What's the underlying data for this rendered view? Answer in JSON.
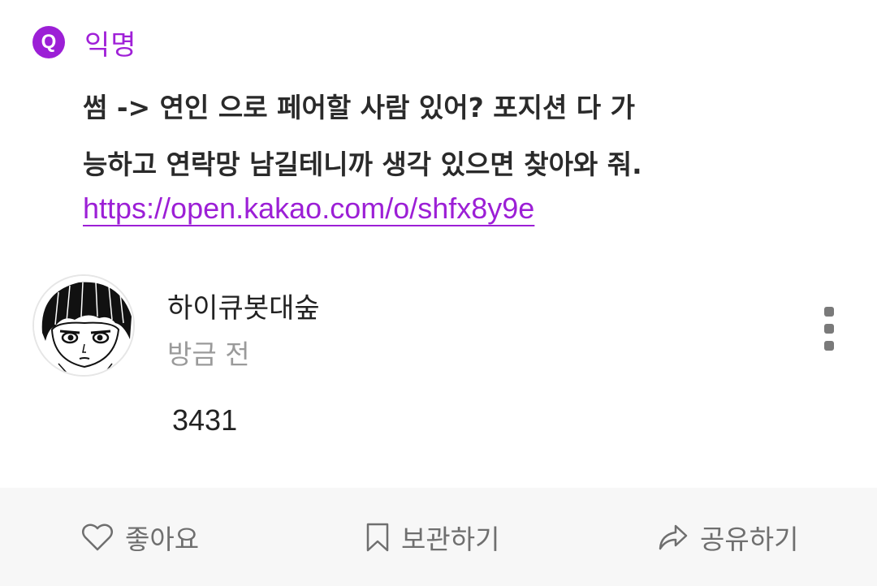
{
  "header": {
    "badge": "Q",
    "anonymous_label": "익명"
  },
  "question": {
    "lines": [
      "썸 -> 연인 으로 페어할 사람 있어? 포지션 다 가",
      "능하고 연락망 남길테니까 생각 있으면 찾아와 줘."
    ],
    "link": "https://open.kakao.com/o/shfx8y9e"
  },
  "answer": {
    "author": "하이큐봇대숲",
    "time": "방금 전",
    "text": "3431"
  },
  "actions": {
    "like_label": "좋아요",
    "save_label": "보관하기",
    "share_label": "공유하기"
  },
  "colors": {
    "accent": "#9c1fd6",
    "bottom_bar": "#f7f7f7",
    "muted_text": "#9a9a9a"
  }
}
